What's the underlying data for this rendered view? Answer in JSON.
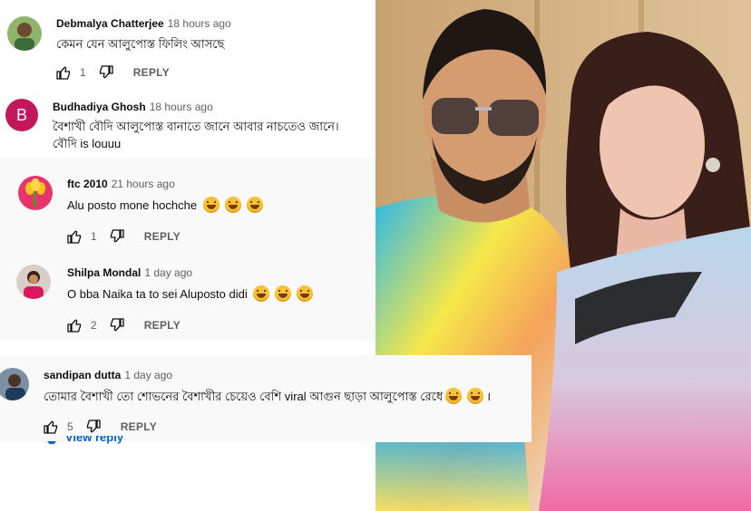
{
  "comments": [
    {
      "author": "Debmalya Chatterjee",
      "time": "18 hours ago",
      "text": "কেমন যেন আলুপোস্ত ফিলিং আসছে",
      "likes": "1",
      "reply_label": "REPLY"
    },
    {
      "author": "Budhadiya Ghosh",
      "time": "18 hours ago",
      "avatar_letter": "B",
      "text_line1": "বৈশাখী বৌদি আলুপোস্ত বানাতে জানে আবার নাচতেও জানে।",
      "text_line2": "বৌদি is louuu"
    },
    {
      "author": "ftc 2010",
      "time": "21 hours ago",
      "text": "Alu posto mone hochche",
      "likes": "1",
      "reply_label": "REPLY"
    },
    {
      "author": "Shilpa Mondal",
      "time": "1 day ago",
      "text": "O bba Naika ta to sei Aluposto didi",
      "likes": "2",
      "reply_label": "REPLY"
    },
    {
      "author": "sandipan dutta",
      "time": "1 day ago",
      "text": "তোমার বৈশাখী তো শোভনের বৈশাখীর চেয়েও বেশি viral আগুন ছাড়া আলুপোস্ত রেধে",
      "text_end": "।",
      "likes": "5",
      "reply_label": "REPLY"
    }
  ],
  "view_reply_label": "View reply",
  "colors": {
    "avatar_b": "#c2185b",
    "link": "#065fd4",
    "meta": "#606060"
  }
}
